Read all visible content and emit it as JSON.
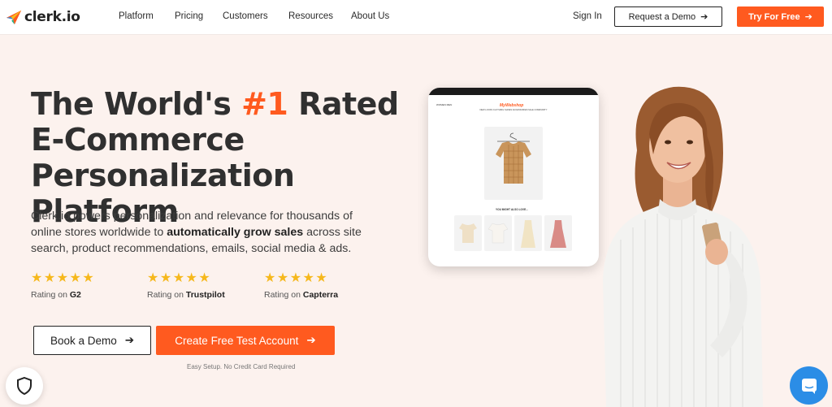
{
  "header": {
    "brand": "clerk.io",
    "nav": [
      {
        "label": "Platform"
      },
      {
        "label": "Pricing"
      },
      {
        "label": "Customers"
      },
      {
        "label": "Resources"
      },
      {
        "label": "About Us"
      }
    ],
    "sign_in": "Sign In",
    "request_demo": "Request a Demo",
    "try_free": "Try For Free"
  },
  "hero": {
    "title_pre": "The World's ",
    "title_accent": "#1",
    "title_post": " Rated",
    "title_line2": "E-Commerce",
    "title_line3": "Personalization Platform",
    "lead_pre": "Clerk.io powers personalization and relevance for thousands of online stores worldwide to ",
    "lead_bold": "automatically grow sales",
    "lead_post": " across site search, product recommendations, emails, social media & ads.",
    "ratings": [
      {
        "stars": "★★★★★",
        "prefix": "Rating on ",
        "source": "G2"
      },
      {
        "stars": "★★★★★",
        "prefix": "Rating on ",
        "source": "Trustpilot"
      },
      {
        "stars": "★★★★★",
        "prefix": "Rating on ",
        "source": "Capterra"
      }
    ],
    "book_demo": "Book a Demo",
    "create_account": "Create Free Test Account",
    "note": "Easy Setup. No Credit Card Required"
  },
  "phone": {
    "shop_logo": "MyWebshop",
    "shop_left": "WOMEN   MEN",
    "menu": "NEW  LOOKS  CLOTHING  SHOES  ACCESSORIES  SALE  COMMUNITY",
    "also": "YOU MIGHT ALSO LOVE..."
  },
  "colors": {
    "accent": "#ff5a1f",
    "hero_bg": "#fcf2ee",
    "stars": "#f6b81c",
    "chat": "#2b8de6"
  },
  "icons": {
    "logo": "paper-plane-icon",
    "arrow": "arrow-right-icon",
    "shield": "shield-icon",
    "chat": "chat-icon"
  }
}
